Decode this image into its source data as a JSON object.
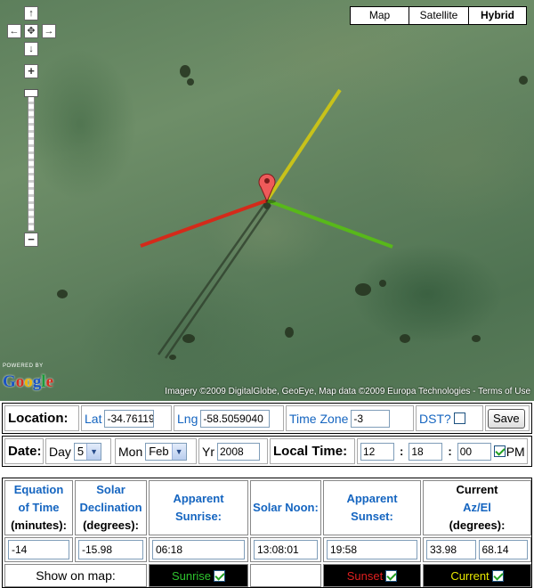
{
  "map": {
    "types": [
      "Map",
      "Satellite",
      "Hybrid"
    ],
    "active_type": "Hybrid",
    "pan": {
      "up": "↑",
      "left": "←",
      "center": "✥",
      "right": "→",
      "down": "↓"
    },
    "zoom": {
      "in": "+",
      "out": "−"
    },
    "logo": {
      "powered": "POWERED BY",
      "letters": [
        "G",
        "o",
        "o",
        "g",
        "l",
        "e"
      ]
    },
    "attribution": "Imagery ©2009 DigitalGlobe, GeoEye, Map data ©2009 Europa Technologies - Terms of Use",
    "line_colors": {
      "sunrise": "#c8c21a",
      "sunset": "#d42a1a",
      "current": "#58b81a"
    },
    "marker_color": "#ee5a5a"
  },
  "location": {
    "label": "Location:",
    "lat_label": "Lat",
    "lat_value": "-34.76119",
    "lng_label": "Lng",
    "lng_value": "-58.5059040",
    "tz_label": "Time Zone",
    "tz_value": "-3",
    "dst_label": "DST?",
    "dst_checked": false,
    "save_label": "Save"
  },
  "date": {
    "label": "Date:",
    "day_label": "Day",
    "day_value": "5",
    "mon_label": "Mon",
    "mon_value": "Feb",
    "yr_label": "Yr",
    "yr_value": "2008",
    "local_time_label": "Local Time:",
    "hour": "12",
    "minute": "18",
    "second": "00",
    "pm_label": "PM",
    "pm_checked": true
  },
  "table": {
    "headers": {
      "eot": [
        "Equation",
        "of Time",
        "(minutes):"
      ],
      "decl": [
        "Solar",
        "Declination",
        "(degrees):"
      ],
      "sunrise": [
        "Apparent",
        "Sunrise:"
      ],
      "noon": [
        "Solar Noon:"
      ],
      "sunset": [
        "Apparent",
        "Sunset:"
      ],
      "current": [
        "Current",
        "Az/El",
        "(degrees):"
      ]
    },
    "values": {
      "eot": "-14",
      "decl": "-15.98",
      "sunrise": "06:18",
      "noon": "13:08:01",
      "sunset": "19:58",
      "az": "33.98",
      "el": "68.14"
    },
    "show_label": "Show on map:",
    "show": {
      "sunrise": "Sunrise",
      "sunset": "Sunset",
      "current": "Current"
    },
    "show_colors": {
      "sunrise": "#2ec42e",
      "sunset": "#e01f1f",
      "current": "#e8e800"
    }
  }
}
